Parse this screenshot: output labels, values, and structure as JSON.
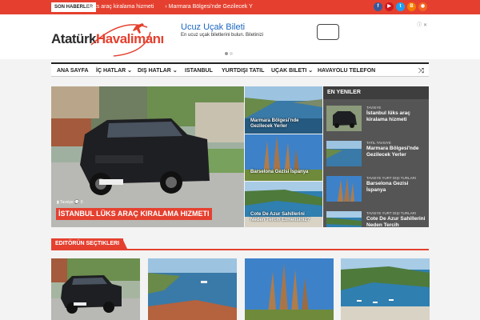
{
  "topbar": {
    "label": "SON HABERLER",
    "ticker_items": [
      "İ lüks araç kiralama hizmeti",
      "› Marmara Bölgesi'nde Gezilecek Y"
    ],
    "social": [
      {
        "name": "facebook",
        "glyph": "f",
        "color": "#3b5998"
      },
      {
        "name": "youtube",
        "glyph": "▶",
        "color": "#cc181e"
      },
      {
        "name": "twitter",
        "glyph": "t",
        "color": "#1da1f2"
      },
      {
        "name": "blogger",
        "glyph": "B",
        "color": "#f57d00"
      },
      {
        "name": "rss",
        "glyph": "◉",
        "color": "#f26522"
      }
    ]
  },
  "header": {
    "logo_part1": "Atatürk",
    "logo_part2": "Havalimanı",
    "logo_color1": "#2b2b2b",
    "logo_color2": "#e5402f"
  },
  "ad": {
    "title": "Ucuz Uçak Bileti",
    "subtitle": "En ucuz uçak biletlerini bulun. Biletinizi",
    "close": "ⓘ ✕"
  },
  "nav": {
    "items": [
      {
        "label": "ANA SAYFA",
        "dropdown": false
      },
      {
        "label": "İÇ HATLAR",
        "dropdown": true
      },
      {
        "label": "DIŞ HATLAR",
        "dropdown": true
      },
      {
        "label": "ISTANBUL",
        "dropdown": false
      },
      {
        "label": "YURTDIŞI TATIL",
        "dropdown": false
      },
      {
        "label": "UÇAK BILETI",
        "dropdown": true
      },
      {
        "label": "HAVAYOLU TELEFON",
        "dropdown": false
      }
    ],
    "active_color": "#e5402f",
    "shuffle_icon": "⤨"
  },
  "featured": {
    "main": {
      "meta": "▮ Tavsiye  💬 0",
      "title": "İSTANBUL LÜKS ARAÇ KIRALAMA HIZMETI"
    },
    "side": [
      {
        "title_lines": [
          "Marmara Bölgesi'nde",
          "Gezilecek Yerler"
        ]
      },
      {
        "title_lines": [
          "Barselona Gezisi İspanya"
        ]
      },
      {
        "title_lines": [
          "Cote De Azur Sahillerini",
          "Neden Tercih Etmelisiniz?"
        ]
      }
    ]
  },
  "latest": {
    "heading": "EN YENILER",
    "items": [
      {
        "category": "TAVSIYE",
        "title": "İstanbul lüks araç kiralama hizmeti"
      },
      {
        "category": "TATIL  TAVSIYE",
        "title": "Marmara Bölgesi'nde Gezilecek Yerler"
      },
      {
        "category": "TAVSIYE  YURT DIŞI TURLARI",
        "title": "Barselona Gezisi İspanya"
      },
      {
        "category": "TAVSIYE  YURT DIŞI TURLARI",
        "title": "Cote De Azur Sahillerini Neden Tercih"
      }
    ]
  },
  "editors": {
    "heading": "EDITÖRÜN SEÇTIKLERI"
  }
}
